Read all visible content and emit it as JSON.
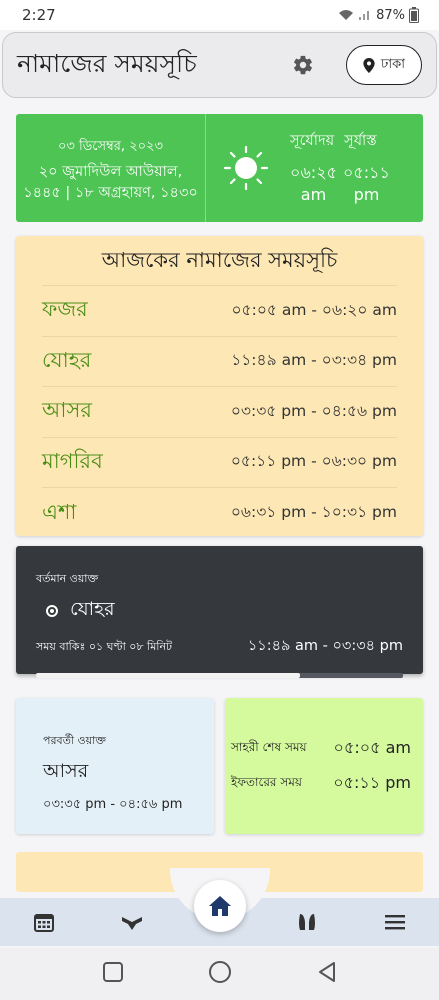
{
  "status_bar": {
    "time": "2:27",
    "battery": "87%"
  },
  "app_bar": {
    "title": "নামাজের সময়সূচি",
    "location": "ঢাকা"
  },
  "date_card": {
    "gregorian": "০৩ ডিসেম্বর, ২০২৩",
    "hijri_line1": "২০ জুমাদিউল আউয়াল,",
    "hijri_line2": "১৪৪৫ | ১৮ অগ্রহায়ণ, ১৪৩০",
    "sunrise_label": "সূর্যোদয়",
    "sunset_label": "সূর্যাস্ত",
    "sunrise_time": "০৬:২৫",
    "sunrise_ampm": "am",
    "sunset_time": "০৫:১১",
    "sunset_ampm": "pm"
  },
  "schedule": {
    "title": "আজকের নামাজের সময়সূচি",
    "prayers": [
      {
        "name": "ফজর",
        "time": "০৫:০৫ am - ০৬:২০ am"
      },
      {
        "name": "যোহর",
        "time": "১১:৪৯ am - ০৩:৩৪ pm"
      },
      {
        "name": "আসর",
        "time": "০৩:৩৫ pm - ০৪:৫৬ pm"
      },
      {
        "name": "মাগরিব",
        "time": "০৫:১১ pm - ০৬:৩০ pm"
      },
      {
        "name": "এশা",
        "time": "০৬:৩১ pm - ১০:৩১ pm"
      }
    ]
  },
  "current_waqt": {
    "label": "বর্তমান ওয়াক্ত",
    "name": "যোহর",
    "remaining": "সময় বাকিঃ ০১ ঘণ্টা ০৮ মিনিট",
    "range": "১১:৪৯ am - ০৩:৩৪ pm",
    "progress": 0.72
  },
  "next_waqt": {
    "label": "পরবর্তী ওয়াক্ত",
    "name": "আসর",
    "range": "০৩:৩৫ pm - ০৪:৫৬ pm"
  },
  "sehri_iftar": {
    "sehri_label": "সাহরী শেষ সময়",
    "sehri_time": "০৫:০৫ am",
    "iftar_label": "ইফতারের সময়",
    "iftar_time": "০৫:১১ pm"
  },
  "icons": {
    "gear": "gear-icon",
    "location": "location-pin-icon",
    "sun": "sun-icon",
    "calendar": "calendar-icon",
    "quran": "quran-icon",
    "home": "home-icon",
    "hands": "prayer-hands-icon",
    "menu": "menu-icon"
  },
  "colors": {
    "date_card": "#4ec455",
    "schedule_card": "#fde8b5",
    "prayer_name": "#4a8d16",
    "current_card": "#35393e",
    "next_card": "#e4f0f8",
    "sehri_card": "#d5fa9e",
    "nav": "#dbe3ee",
    "home_icon": "#1e3a6d"
  }
}
